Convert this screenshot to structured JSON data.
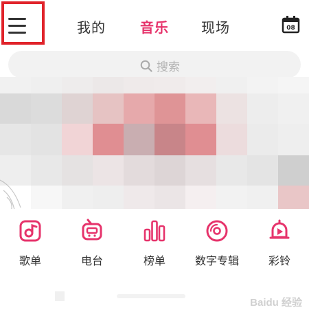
{
  "header": {
    "menu_icon": "hamburger-menu-icon",
    "tabs": [
      {
        "label": "我的",
        "active": false
      },
      {
        "label": "音乐",
        "active": true
      },
      {
        "label": "现场",
        "active": false
      }
    ],
    "calendar_icon": "calendar-icon",
    "calendar_day": "08"
  },
  "search": {
    "icon": "search-icon",
    "placeholder": "搜索"
  },
  "categories": [
    {
      "label": "歌单",
      "icon": "playlist-icon"
    },
    {
      "label": "电台",
      "icon": "radio-icon"
    },
    {
      "label": "榜单",
      "icon": "chart-bars-icon"
    },
    {
      "label": "数字专辑",
      "icon": "vinyl-album-icon"
    },
    {
      "label": "彩铃",
      "icon": "ringtone-bell-icon"
    }
  ],
  "colors": {
    "accent": "#e6336b",
    "highlight_box": "#e0232a",
    "search_bg": "#f2f2f2"
  },
  "watermark": "Baidu 经验"
}
